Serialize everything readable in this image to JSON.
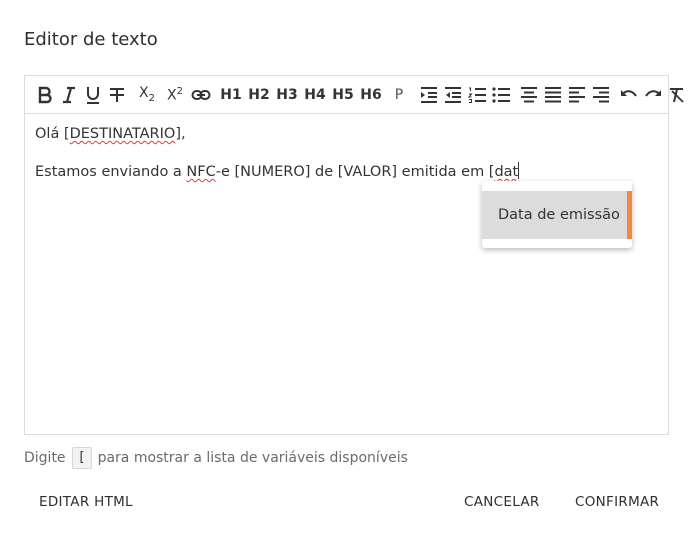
{
  "dialog": {
    "title": "Editor de texto"
  },
  "toolbar": {
    "subscript_label": "X",
    "subscript_sub": "2",
    "superscript_label": "X",
    "superscript_sup": "2",
    "h1": "H1",
    "h2": "H2",
    "h3": "H3",
    "h4": "H4",
    "h5": "H5",
    "h6": "H6",
    "paragraph": "P"
  },
  "content": {
    "line1_prefix": "Olá [",
    "line1_word": "DESTINATARIO",
    "line1_suffix": "],",
    "line2_part1": "Estamos enviando a ",
    "line2_nfc": "NFC",
    "line2_part2": "-e [NUMERO] de [VALOR] emitida em [",
    "line2_typed": "dat"
  },
  "autocomplete": {
    "item": "Data de emissão"
  },
  "hint": {
    "before": "Digite",
    "key": "[",
    "after": "para mostrar a lista de variáveis disponíveis"
  },
  "actions": {
    "edit_html": "EDITAR HTML",
    "cancel": "CANCELAR",
    "confirm": "CONFIRMAR"
  },
  "colors": {
    "accent": "#f08a3c",
    "spellcheck": "#e23b3b",
    "highlight": "#dcdcdc"
  }
}
